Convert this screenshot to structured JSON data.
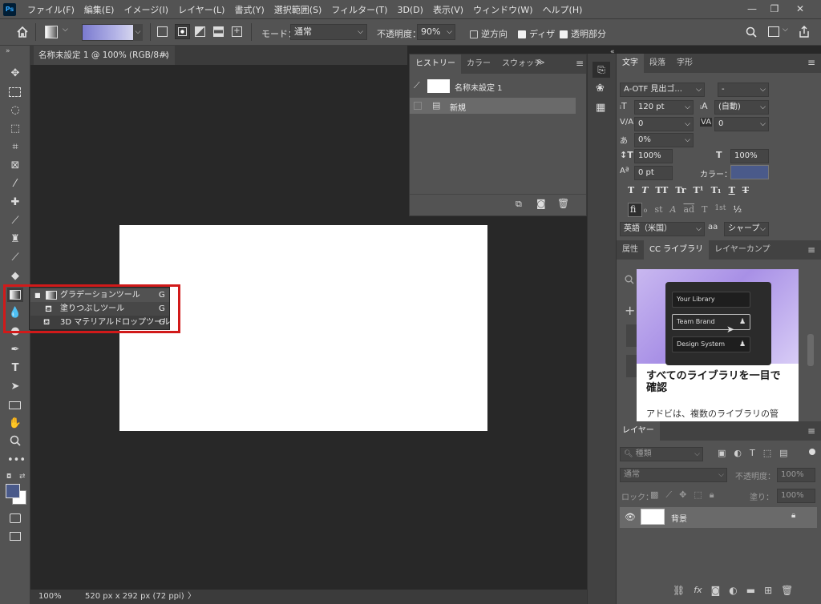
{
  "menubar": {
    "logo": "Ps",
    "items": [
      "ファイル(F)",
      "編集(E)",
      "イメージ(I)",
      "レイヤー(L)",
      "書式(Y)",
      "選択範囲(S)",
      "フィルター(T)",
      "3D(D)",
      "表示(V)",
      "ウィンドウ(W)",
      "ヘルプ(H)"
    ],
    "minimize": "—",
    "restore": "❐",
    "close": "✕"
  },
  "options": {
    "mode_label": "モード：",
    "mode_value": "通常",
    "opacity_label": "不透明度：",
    "opacity_value": "90%",
    "reverse_label": "逆方向",
    "dither_label": "ディザ",
    "transparency_label": "透明部分",
    "reverse_checked": false,
    "dither_checked": true,
    "transparency_checked": true
  },
  "document": {
    "tab_title": "名称未設定 1 @ 100% (RGB/8#)",
    "close": "×",
    "zoom": "100%",
    "size_info": "520 px x 292 px (72 ppi)",
    "arrow": "〉"
  },
  "flyout": {
    "items": [
      {
        "label": "グラデーションツール",
        "key": "G",
        "icon": "gradient-tool-icon"
      },
      {
        "label": "塗りつぶしツール",
        "key": "G",
        "icon": "paint-bucket-icon"
      },
      {
        "label": "3D マテリアルドロップツール",
        "key": "G",
        "icon": "3d-material-drop-icon"
      }
    ]
  },
  "history": {
    "tabs": [
      "ヒストリー",
      "カラー",
      "スウォッチ"
    ],
    "snapshot": "名称未設定 1",
    "states": [
      "新規"
    ],
    "more": "≫",
    "menu": "≡"
  },
  "character": {
    "tabs": [
      "文字",
      "段落",
      "字形"
    ],
    "font_family": "A-OTF 見出ゴ...",
    "font_style": "-",
    "font_size": "120 pt",
    "leading": "(自動)",
    "kerning": "0",
    "tracking": "0",
    "tsume": "0%",
    "vscale": "100%",
    "hscale": "100%",
    "baseline": "0 pt",
    "color_label": "カラー：",
    "color_swatch": "#4a5a8a",
    "language": "英語（米国）",
    "aa_label": "aa",
    "antialias": "シャープ",
    "style_buttons": [
      "T",
      "T",
      "TT",
      "Tr",
      "T¹",
      "T₁",
      "T",
      "T"
    ],
    "ot_buttons": [
      "fi",
      "ℴ",
      "st",
      "A",
      "ad",
      "T",
      "1st",
      "½"
    ]
  },
  "library": {
    "tabs": [
      "属性",
      "CC ライブラリ",
      "レイヤーカンプ"
    ],
    "card_items": [
      "Your Library",
      "Team Brand",
      "Design System"
    ],
    "headline": "すべてのライブラリを一目で確認",
    "body": "アドビは、複数のライブラリの管"
  },
  "layers": {
    "tab": "レイヤー",
    "search_placeholder": "種類",
    "blend": "通常",
    "opacity_label": "不透明度：",
    "opacity": "100%",
    "lock_label": "ロック：",
    "fill_label": "塗り：",
    "fill": "100%",
    "layer_name": "背景"
  }
}
